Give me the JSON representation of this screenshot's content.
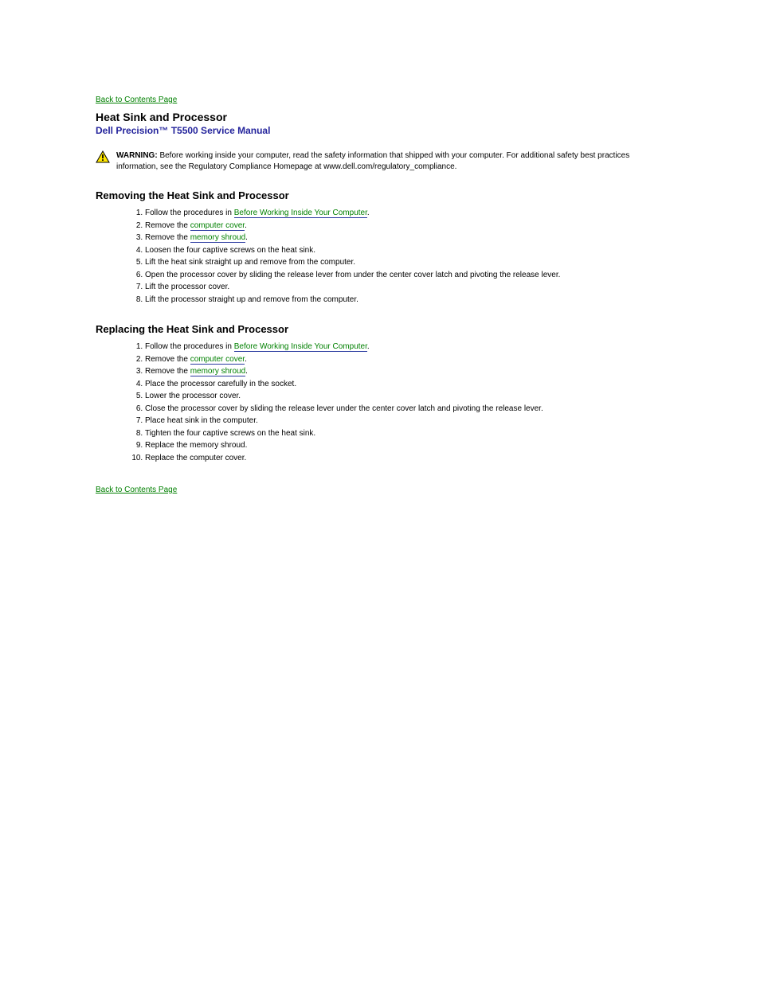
{
  "topBack": "Back to Contents Page",
  "title": "Heat Sink and Processor",
  "subtitle": "Dell Precision™ T5500 Service Manual",
  "warningLabel": "WARNING:",
  "warningBody": " Before working inside your computer, read the safety information that shipped with your computer. For additional safety best practices information, see the Regulatory Compliance Homepage at www.dell.com/regulatory_compliance.",
  "removing": {
    "heading": "Removing the Heat Sink and Processor",
    "steps": [
      {
        "prefix": "Follow the procedures in ",
        "link": "Before Working Inside Your Computer",
        "suffix": "."
      },
      {
        "prefix": "Remove the ",
        "link": "computer cover",
        "suffix": "."
      },
      {
        "prefix": "Remove the ",
        "link": "memory shroud",
        "suffix": "."
      },
      {
        "prefix": "Loosen the four captive screws on the heat sink.",
        "link": "",
        "suffix": ""
      },
      {
        "prefix": "Lift the heat sink straight up and remove from the computer.",
        "link": "",
        "suffix": ""
      },
      {
        "prefix": "Open the processor cover by sliding the release lever from under the center cover latch and pivoting the release lever.",
        "link": "",
        "suffix": ""
      },
      {
        "prefix": "Lift the processor cover.",
        "link": "",
        "suffix": ""
      },
      {
        "prefix": "Lift the processor straight up and remove from the computer.",
        "link": "",
        "suffix": ""
      }
    ]
  },
  "replacing": {
    "heading": "Replacing the Heat Sink and Processor",
    "steps": [
      {
        "prefix": "Follow the procedures in ",
        "link": "Before Working Inside Your Computer",
        "suffix": "."
      },
      {
        "prefix": "Remove the ",
        "link": "computer cover",
        "suffix": "."
      },
      {
        "prefix": "Remove the ",
        "link": "memory shroud",
        "suffix": "."
      },
      {
        "prefix": "Place the processor carefully in the socket.",
        "link": "",
        "suffix": ""
      },
      {
        "prefix": "Lower the processor cover.",
        "link": "",
        "suffix": ""
      },
      {
        "prefix": "Close the processor cover by sliding the release lever under the center cover latch and pivoting the release lever.",
        "link": "",
        "suffix": ""
      },
      {
        "prefix": "Place heat sink in the computer.",
        "link": "",
        "suffix": ""
      },
      {
        "prefix": "Tighten the four captive screws on the heat sink.",
        "link": "",
        "suffix": ""
      },
      {
        "prefix": "Replace the memory shroud.",
        "link": "",
        "suffix": ""
      },
      {
        "prefix": "Replace the computer cover.",
        "link": "",
        "suffix": ""
      }
    ]
  },
  "bottomBack": "Back to Contents Page"
}
